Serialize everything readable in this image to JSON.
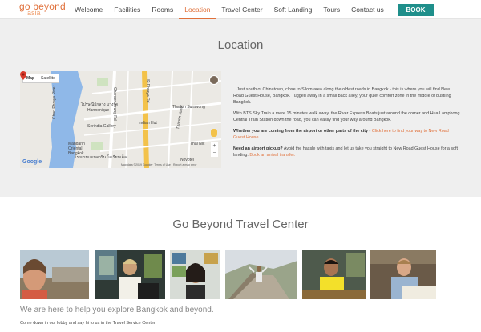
{
  "header": {
    "logo_main": "go beyond",
    "logo_sub": "asia",
    "nav": [
      {
        "label": "Welcome",
        "active": false
      },
      {
        "label": "Facilities",
        "active": false
      },
      {
        "label": "Rooms",
        "active": false
      },
      {
        "label": "Location",
        "active": true
      },
      {
        "label": "Travel Center",
        "active": false
      },
      {
        "label": "Soft Landing",
        "active": false
      },
      {
        "label": "Tours",
        "active": false
      },
      {
        "label": "Contact us",
        "active": false
      }
    ],
    "book_label": "BOOK",
    "accent_color": "#e0703a",
    "book_color": "#1f8f8b"
  },
  "location": {
    "title": "Location",
    "map": {
      "toggle_map": "Map",
      "toggle_satellite": "Satellite",
      "labels": {
        "river": "Chao Phraya River",
        "harmonique": "Harmonique",
        "thai1": "ไปรษณีย์กลาง บางรัก",
        "serindia": "Serindia Gallery",
        "mandarin": "Mandarin Oriental Bangkok",
        "thai2": "โรงแรมแมนดาริน โอเรียนเต็ล",
        "indian_hut": "Indian Hut",
        "surawong": "Thanon Surawong",
        "thai_nic": "Thai Nic",
        "novotel": "Novotel",
        "road_charoen": "Charoen Krung Rd",
        "road_fuang": "Si Phraya Rd",
        "road_nakhon": "Thanon Naret"
      },
      "google": "Google",
      "footer": "Map data ©2019 Google · Terms of Use · Report a map error"
    },
    "paragraphs": [
      "...Just south of Chinatown, close to Silom area along the oldest roads in Bangkok - this is where you will find New Road Guest House, Bangkok. Tugged away in a small back alley, your quiet comfort zone in the middle of bustling Bangkok.",
      "With BTS Sky Train a mere 15 minutes walk away, the River Express Boats just around the corner and Hua Lamphong Central Train Station down the road, you can easily find your way around Bangkok."
    ],
    "airport_bold": "Whether you are coming from the airport or other parts of the city - ",
    "airport_link": "Click here to find your way to New Road Guest House",
    "pickup_bold": "Need an airport pickup?",
    "pickup_text": " Avoid the hassle with taxis and let us take you straight to New Road Guest House for a soft landing. ",
    "pickup_link": "Book an arrival transfer."
  },
  "travel_center": {
    "title": "Go Beyond Travel Center",
    "subtitle": "We are here to help you explore Bangkok and beyond.",
    "note": "Come down in our lobby and say hi to us in the Travel Service Center."
  }
}
